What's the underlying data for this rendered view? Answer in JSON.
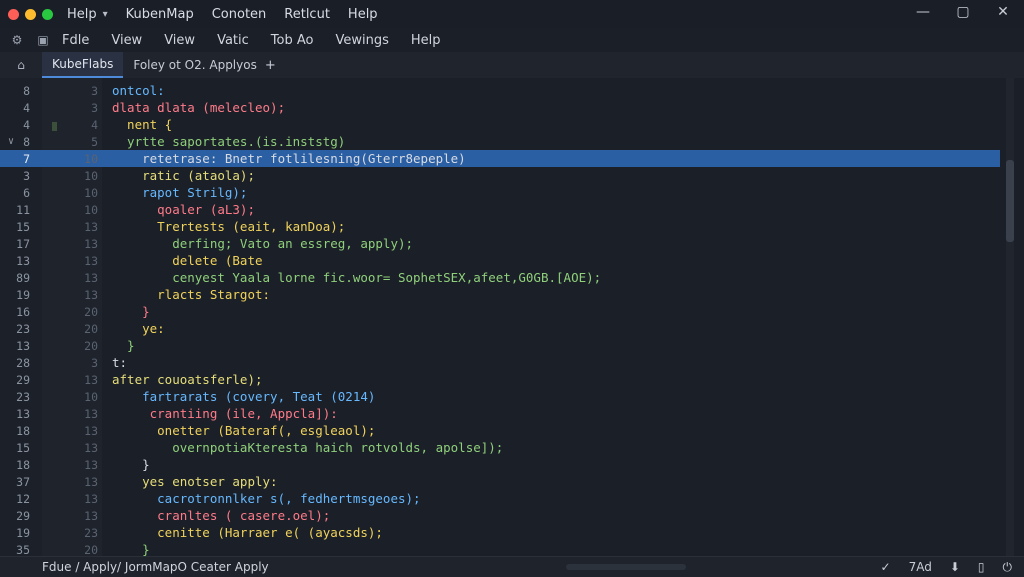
{
  "window": {
    "menu_top": [
      "Help",
      "KubenMap",
      "Conoten",
      "Retlcut",
      "Help"
    ],
    "controls": [
      "—",
      "▢",
      "✕"
    ]
  },
  "menubar2": {
    "items": [
      "Fdle",
      "View",
      "View",
      "Vatic",
      "Tob Ao",
      "Vewings",
      "Help"
    ]
  },
  "tabs": {
    "items": [
      {
        "label": "KubeFlabs"
      },
      {
        "label": "Foley ot O2.  Applyos"
      }
    ],
    "new_tab": "+"
  },
  "editor": {
    "lines": [
      {
        "ln": "8",
        "ln2": "3",
        "code": "ontcol:"
      },
      {
        "ln": "4",
        "ln2": "3",
        "code": "dlata dlata (melecleo);"
      },
      {
        "ln": "4",
        "ln2": "4",
        "code": "  nent {"
      },
      {
        "ln": "8",
        "ln2": "5",
        "code": "  yrtte saportates.(is.inststg)"
      },
      {
        "ln": "7",
        "ln2": "10",
        "code": "    retetrase: Bnetr fotlilesning(Gterr8epeple)"
      },
      {
        "ln": "3",
        "ln2": "10",
        "code": "    ratic (ataola);"
      },
      {
        "ln": "6",
        "ln2": "10",
        "code": "    rapot Strilg);"
      },
      {
        "ln": "11",
        "ln2": "10",
        "code": "      qoaler (aL3);"
      },
      {
        "ln": "15",
        "ln2": "13",
        "code": "      Trertests (eait, kanDoa);"
      },
      {
        "ln": "17",
        "ln2": "13",
        "code": "        derfing; Vato an essreg, apply);"
      },
      {
        "ln": "13",
        "ln2": "13",
        "code": "        delete (Bate "
      },
      {
        "ln": "89",
        "ln2": "13",
        "code": "        cenyest Yaala lorne fic.woor= SophetSEX,afeet,G0GB.[AOE);"
      },
      {
        "ln": "19",
        "ln2": "13",
        "code": "      rlacts Stargot:"
      },
      {
        "ln": "16",
        "ln2": "20",
        "code": "    }"
      },
      {
        "ln": "23",
        "ln2": "20",
        "code": "    ye:"
      },
      {
        "ln": "13",
        "ln2": "20",
        "code": "  }"
      },
      {
        "ln": "28",
        "ln2": "3",
        "code": "t:"
      },
      {
        "ln": "29",
        "ln2": "13",
        "code": "after couoatsferle);"
      },
      {
        "ln": "23",
        "ln2": "10",
        "code": "    fartrarats (covery, Teat (0214)"
      },
      {
        "ln": "13",
        "ln2": "13",
        "code": "     crantiing (ile, Appcla]):"
      },
      {
        "ln": "18",
        "ln2": "13",
        "code": "      onetter (Bateraf(, esgleaol);"
      },
      {
        "ln": "15",
        "ln2": "13",
        "code": "        overnpotiaKteresta haich rotvolds, apolse]);"
      },
      {
        "ln": "18",
        "ln2": "13",
        "code": "    }"
      },
      {
        "ln": "37",
        "ln2": "13",
        "code": "    yes enotser apply:"
      },
      {
        "ln": "12",
        "ln2": "13",
        "code": "      cacrotronnlker s(, fedhertmsgeoes);"
      },
      {
        "ln": "29",
        "ln2": "13",
        "code": "      cranltes ( casere.oel);"
      },
      {
        "ln": "19",
        "ln2": "23",
        "code": "      cenitte (Harraer e( (ayacsds);"
      },
      {
        "ln": "35",
        "ln2": "20",
        "code": "    }"
      }
    ]
  },
  "status": {
    "left": "Fdue / Apply/ JormMapO Ceater Apply",
    "right": [
      "✓",
      "7Ad",
      "⬇",
      "▯",
      "⏻"
    ]
  },
  "colors": {
    "accent": "#4d8ad9",
    "highlight_line": "#2b5fa3",
    "bg": "#1b1f27"
  }
}
